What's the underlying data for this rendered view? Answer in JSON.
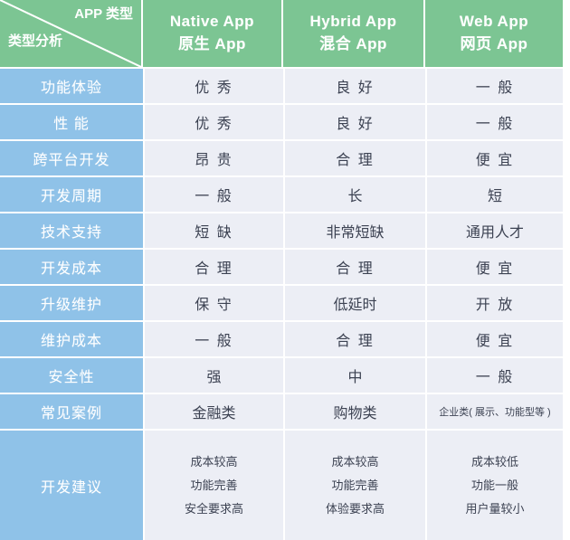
{
  "table": {
    "corner": {
      "top_label": "APP 类型",
      "bottom_label": "类型分析",
      "diagonal_icon": "diagonal-divider-line"
    },
    "columns": [
      {
        "en": "Native App",
        "cn": "原生 App"
      },
      {
        "en": "Hybrid App",
        "cn": "混合 App"
      },
      {
        "en": "Web App",
        "cn": "网页 App"
      }
    ],
    "rows": [
      {
        "label": "功能体验",
        "native": "优 秀",
        "hybrid": "良 好",
        "web": "一 般"
      },
      {
        "label": "性 能",
        "native": "优 秀",
        "hybrid": "良 好",
        "web": "一 般"
      },
      {
        "label": "跨平台开发",
        "native": "昂 贵",
        "hybrid": "合 理",
        "web": "便 宜"
      },
      {
        "label": "开发周期",
        "native": "一 般",
        "hybrid": "长",
        "web": "短"
      },
      {
        "label": "技术支持",
        "native": "短 缺",
        "hybrid": "非常短缺",
        "web": "通用人才"
      },
      {
        "label": "开发成本",
        "native": "合 理",
        "hybrid": "合 理",
        "web": "便 宜"
      },
      {
        "label": "升级维护",
        "native": "保 守",
        "hybrid": "低延时",
        "web": "开 放"
      },
      {
        "label": "维护成本",
        "native": "一 般",
        "hybrid": "合 理",
        "web": "便 宜"
      },
      {
        "label": "安全性",
        "native": "强",
        "hybrid": "中",
        "web": "一 般"
      },
      {
        "label": "常见案例",
        "native": "金融类",
        "hybrid": "购物类",
        "web": "企业类( 展示、功能型等 )"
      }
    ],
    "advice": {
      "label": "开发建议",
      "native": [
        "成本较高",
        "功能完善",
        "安全要求高"
      ],
      "hybrid": [
        "成本较高",
        "功能完善",
        "体验要求高"
      ],
      "web": [
        "成本较低",
        "功能一般",
        "用户量较小"
      ]
    },
    "colors": {
      "header_green": "#7cc593",
      "label_blue": "#8fc2e8",
      "value_bg": "#eceef5",
      "value_text": "#3c4252",
      "grid_white": "#ffffff"
    }
  }
}
